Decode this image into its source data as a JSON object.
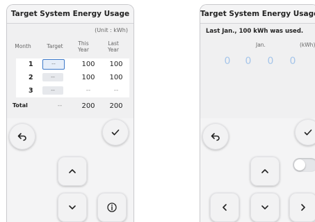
{
  "left": {
    "title": "Target System Energy Usage",
    "unit": "(Unit : kWh)",
    "headers": {
      "month": "Month",
      "target": "Target",
      "this_year": "This Year",
      "last_year": "Last Year"
    },
    "rows": [
      {
        "month": "1",
        "target": "--",
        "this_year": "100",
        "last_year": "100"
      },
      {
        "month": "2",
        "target": "--",
        "this_year": "100",
        "last_year": "100"
      },
      {
        "month": "3",
        "target": "--",
        "this_year": "--",
        "last_year": "--"
      }
    ],
    "total": {
      "label": "Total",
      "target": "--",
      "this_year": "200",
      "last_year": "200"
    }
  },
  "right": {
    "title": "Target System Energy Usage",
    "message": "Last Jan., 100 kWh was used.",
    "month_label": "Jan.",
    "unit_label": "(kWh)",
    "digits": [
      "0",
      "0",
      "0",
      "0"
    ],
    "toggle_on": false
  },
  "icons": [
    "back-icon",
    "check-icon",
    "chevron-up-icon",
    "chevron-down-icon",
    "chevron-left-icon",
    "chevron-right-icon",
    "info-icon"
  ],
  "colors": {
    "selected_border": "#3c78c8",
    "digit": "#a5c5ea",
    "panel_bg": "#f4f4f5"
  }
}
